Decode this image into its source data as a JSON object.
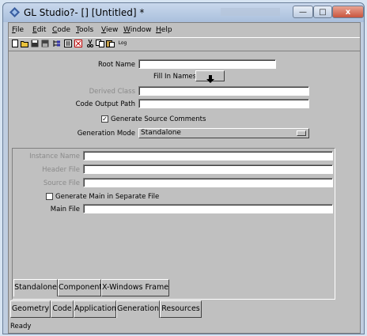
{
  "window": {
    "title": "GL Studio?- [] [Untitled] *",
    "minimize_glyph": "—",
    "maximize_glyph": "□",
    "close_glyph": "x"
  },
  "menu": [
    "File",
    "Edit",
    "Code",
    "Tools",
    "View",
    "Window",
    "Help"
  ],
  "toolbar": {
    "icons": [
      "new-file-icon",
      "open-folder-icon",
      "save-icon",
      "save-all-icon",
      "tree-icon",
      "list-icon",
      "grid-icon",
      "cut-icon",
      "copy-icon",
      "paste-icon",
      "log-icon"
    ],
    "log_label": "Log"
  },
  "form": {
    "root_name_label": "Root Name",
    "root_name_value": "",
    "fill_in_names_label": "Fill In Names",
    "derived_class_label": "Derived Class",
    "derived_class_value": "",
    "code_output_path_label": "Code Output Path",
    "code_output_path_value": "",
    "generate_source_comments_label": "Generate Source Comments",
    "generate_source_comments_checked": true,
    "generation_mode_label": "Generation Mode",
    "generation_mode_value": "Standalone"
  },
  "standalone_panel": {
    "instance_name_label": "Instance Name",
    "header_file_label": "Header File",
    "source_file_label": "Source File",
    "generate_main_label": "Generate Main in Separate File",
    "generate_main_checked": false,
    "main_file_label": "Main File",
    "main_file_value": ""
  },
  "mode_tabs": [
    "Standalone",
    "Component",
    "X-Windows Frame"
  ],
  "section_tabs": [
    "Geometry",
    "Code",
    "Application",
    "Generation",
    "Resources"
  ],
  "status": "Ready",
  "colors": {
    "face": "#c0c0c0",
    "title_bar": "#a9bfdc",
    "close": "#c8553e"
  }
}
